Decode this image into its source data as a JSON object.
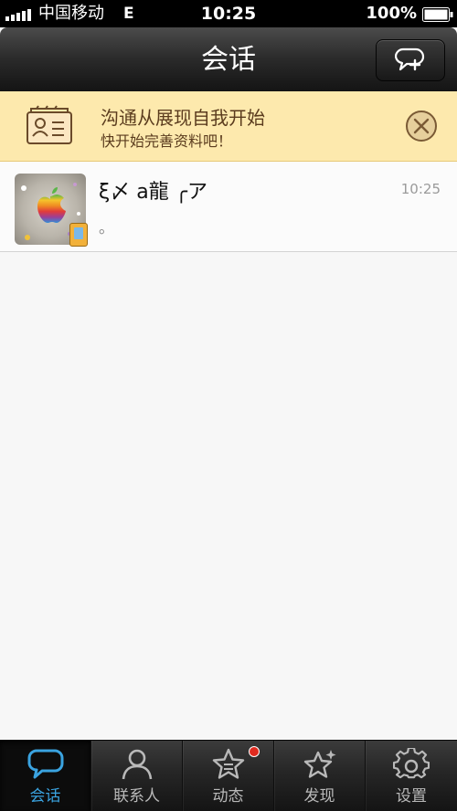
{
  "status_bar": {
    "carrier": "中国移动",
    "network": "E",
    "time": "10:25",
    "battery": "100%",
    "signal_bars": 5
  },
  "nav": {
    "title": "会话",
    "compose_icon": "new-chat-icon"
  },
  "banner": {
    "title": "沟通从展现自我开始",
    "subtitle": "快开始完善资料吧！",
    "icon": "profile-card-icon",
    "close_icon": "close-icon"
  },
  "chats": [
    {
      "name": "ξ〆 a龍 ╭ア",
      "time": "10:25",
      "preview": "。",
      "avatar": "apple-logo-avatar"
    }
  ],
  "tabs": [
    {
      "label": "会话",
      "icon": "chat-bubble-icon",
      "active": true
    },
    {
      "label": "联系人",
      "icon": "person-icon",
      "active": false
    },
    {
      "label": "动态",
      "icon": "star-icon",
      "active": false,
      "badge": true
    },
    {
      "label": "发现",
      "icon": "sparkle-star-icon",
      "active": false
    },
    {
      "label": "设置",
      "icon": "gear-icon",
      "active": false
    }
  ],
  "colors": {
    "accent": "#3aa3e0",
    "banner_bg": "#fde9ad",
    "badge": "#e02a1f"
  }
}
